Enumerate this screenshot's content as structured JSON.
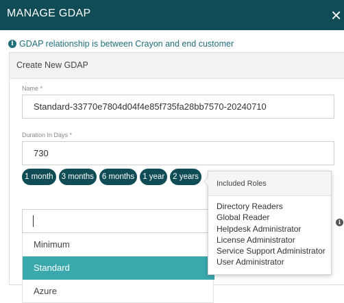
{
  "header": {
    "title": "MANAGE GDAP",
    "close_label": "×"
  },
  "info": {
    "icon": "info-icon",
    "text": "GDAP relationship is between Crayon and end customer"
  },
  "panel": {
    "title": "Create New GDAP"
  },
  "form": {
    "name_label": "Name *",
    "name_value": "Standard-33770e7804d04f4e85f735fa28bb7570-20240710",
    "duration_label": "Duration In Days *",
    "duration_value": "730"
  },
  "duration_presets": [
    "1 month",
    "3 months",
    "6 months",
    "1 year",
    "2 years"
  ],
  "role_select": {
    "value": "",
    "options": [
      {
        "label": "Minimum",
        "selected": false
      },
      {
        "label": "Standard",
        "selected": true
      },
      {
        "label": "Azure",
        "selected": false
      }
    ]
  },
  "roles_popover": {
    "title": "Included Roles",
    "roles": [
      "Directory Readers",
      "Global Reader",
      "Helpdesk Administrator",
      "License Administrator",
      "Service Support Administrator",
      "User Administrator"
    ]
  },
  "colors": {
    "header_bg": "#0f4c55",
    "accent": "#1f6e7a",
    "selected_option": "#3aa9ae"
  }
}
